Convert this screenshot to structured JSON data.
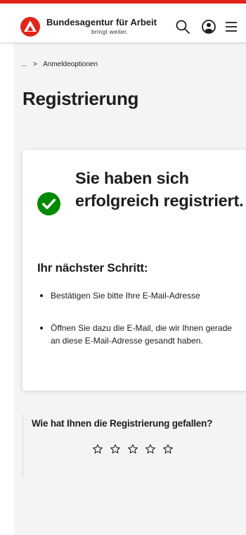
{
  "header": {
    "brand_name": "Bundesagentur für Arbeit",
    "brand_tagline": "bringt weiter.",
    "accent_color": "#e2231a",
    "icons": [
      "logo-icon",
      "search-icon",
      "account-icon",
      "menu-icon"
    ]
  },
  "breadcrumb": {
    "ellipsis": "...",
    "separator": ">",
    "current": "Anmeldeoptionen"
  },
  "page": {
    "title": "Registrierung"
  },
  "success_card": {
    "icon": "check-circle-icon",
    "icon_color": "#008a00",
    "title": "Sie haben sich erfolgreich registriert.",
    "next_heading": "Ihr nächster Schritt:",
    "steps": [
      "Bestätigen Sie bitte Ihre E-Mail-Adresse",
      "Öffnen Sie dazu die E-Mail, die wir Ihnen gerade an diese E-Mail-Adresse gesandt haben."
    ]
  },
  "feedback": {
    "question": "Wie hat Ihnen die Registrierung gefallen?",
    "star_count": 5,
    "rating": 0
  }
}
